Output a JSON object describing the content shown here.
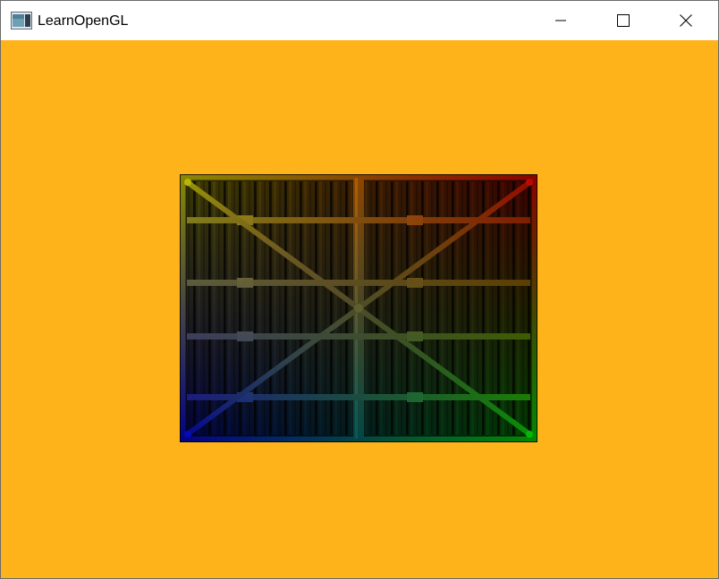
{
  "window": {
    "title": "LearnOpenGL",
    "app_icon": "opengl-window-icon",
    "controls": {
      "minimize_icon": "minimize-icon",
      "maximize_icon": "maximize-icon",
      "close_icon": "close-icon"
    }
  },
  "scene": {
    "clear_color": "#FFB31A",
    "quad": {
      "texture": "wooden-container-texture",
      "vertex_colors": {
        "top_right": "#FF0000",
        "bottom_right": "#00FF00",
        "bottom_left": "#0000FF",
        "top_left": "#FFFF00"
      }
    }
  }
}
